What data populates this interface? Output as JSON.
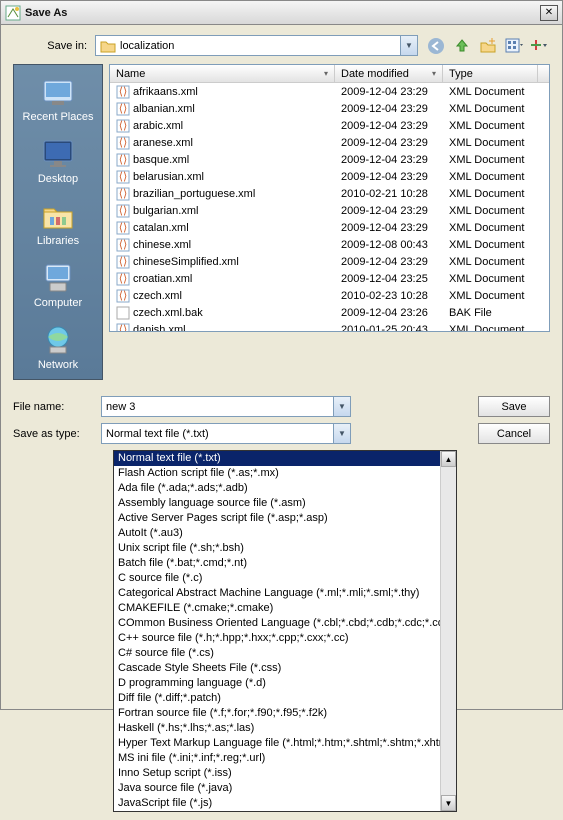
{
  "title": "Save As",
  "save_in_label": "Save in:",
  "save_in_value": "localization",
  "columns": {
    "name": "Name",
    "date": "Date modified",
    "type": "Type"
  },
  "sidebar": [
    {
      "label": "Recent Places",
      "icon": "recent"
    },
    {
      "label": "Desktop",
      "icon": "desktop"
    },
    {
      "label": "Libraries",
      "icon": "libraries"
    },
    {
      "label": "Computer",
      "icon": "computer"
    },
    {
      "label": "Network",
      "icon": "network"
    }
  ],
  "files": [
    {
      "name": "afrikaans.xml",
      "date": "2009-12-04 23:29",
      "type": "XML Document",
      "bak": false
    },
    {
      "name": "albanian.xml",
      "date": "2009-12-04 23:29",
      "type": "XML Document",
      "bak": false
    },
    {
      "name": "arabic.xml",
      "date": "2009-12-04 23:29",
      "type": "XML Document",
      "bak": false
    },
    {
      "name": "aranese.xml",
      "date": "2009-12-04 23:29",
      "type": "XML Document",
      "bak": false
    },
    {
      "name": "basque.xml",
      "date": "2009-12-04 23:29",
      "type": "XML Document",
      "bak": false
    },
    {
      "name": "belarusian.xml",
      "date": "2009-12-04 23:29",
      "type": "XML Document",
      "bak": false
    },
    {
      "name": "brazilian_portuguese.xml",
      "date": "2010-02-21 10:28",
      "type": "XML Document",
      "bak": false
    },
    {
      "name": "bulgarian.xml",
      "date": "2009-12-04 23:29",
      "type": "XML Document",
      "bak": false
    },
    {
      "name": "catalan.xml",
      "date": "2009-12-04 23:29",
      "type": "XML Document",
      "bak": false
    },
    {
      "name": "chinese.xml",
      "date": "2009-12-08 00:43",
      "type": "XML Document",
      "bak": false
    },
    {
      "name": "chineseSimplified.xml",
      "date": "2009-12-04 23:29",
      "type": "XML Document",
      "bak": false
    },
    {
      "name": "croatian.xml",
      "date": "2009-12-04 23:25",
      "type": "XML Document",
      "bak": false
    },
    {
      "name": "czech.xml",
      "date": "2010-02-23 10:28",
      "type": "XML Document",
      "bak": false
    },
    {
      "name": "czech.xml.bak",
      "date": "2009-12-04 23:26",
      "type": "BAK File",
      "bak": true
    },
    {
      "name": "danish.xml",
      "date": "2010-01-25 20:43",
      "type": "XML Document",
      "bak": false
    }
  ],
  "file_name_label": "File name:",
  "file_name_value": "new  3",
  "save_type_label": "Save as type:",
  "save_type_value": "Normal text file (*.txt)",
  "save_btn": "Save",
  "cancel_btn": "Cancel",
  "type_options": [
    "Normal text file (*.txt)",
    "Flash Action script file (*.as;*.mx)",
    "Ada file (*.ada;*.ads;*.adb)",
    "Assembly language source file (*.asm)",
    "Active Server Pages script file (*.asp;*.asp)",
    "AutoIt (*.au3)",
    "Unix script file (*.sh;*.bsh)",
    "Batch file (*.bat;*.cmd;*.nt)",
    "C source file (*.c)",
    "Categorical Abstract Machine Language (*.ml;*.mli;*.sml;*.thy)",
    "CMAKEFILE (*.cmake;*.cmake)",
    "COmmon Business Oriented Language (*.cbl;*.cbd;*.cdb;*.cdc;*.cob)",
    "C++ source file (*.h;*.hpp;*.hxx;*.cpp;*.cxx;*.cc)",
    "C# source file (*.cs)",
    "Cascade Style Sheets File (*.css)",
    "D programming language (*.d)",
    "Diff file (*.diff;*.patch)",
    "Fortran source file (*.f;*.for;*.f90;*.f95;*.f2k)",
    "Haskell (*.hs;*.lhs;*.as;*.las)",
    "Hyper Text Markup Language file (*.html;*.htm;*.shtml;*.shtm;*.xhtml)",
    "MS ini file (*.ini;*.inf;*.reg;*.url)",
    "Inno Setup script (*.iss)",
    "Java source file (*.java)",
    "JavaScript file (*.js)"
  ],
  "type_selected_index": 0
}
